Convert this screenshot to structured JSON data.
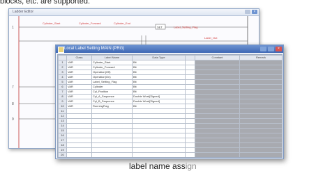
{
  "captions": {
    "top": "blocks, etc. are supported.",
    "bottom": "label name ass",
    "bottom_faint": "ign"
  },
  "back_window": {
    "title": "Ladder Editor",
    "rung_numbers": [
      "1",
      "7",
      "8",
      "9"
    ],
    "coil_labels": [
      "Cylinder_Start",
      "Cylinder_Forward",
      "Cylinder_End",
      "SET",
      "Label_Setting_Flag",
      "Label_Out"
    ]
  },
  "front_window": {
    "title": "Local Label Setting MAIN (PRG)",
    "columns": [
      "",
      "Class",
      "Label Name",
      "Data Type",
      "",
      "Constant",
      "Remark"
    ],
    "rows": [
      {
        "n": "1",
        "class": "VAR",
        "name": "Cylinder_Start",
        "type": "Bit"
      },
      {
        "n": "2",
        "class": "VAR",
        "name": "Cylinder_Forward",
        "type": "Bit"
      },
      {
        "n": "3",
        "class": "VAR",
        "name": "Operation(Off)",
        "type": "Bit"
      },
      {
        "n": "4",
        "class": "VAR",
        "name": "Operation(On)",
        "type": "Bit"
      },
      {
        "n": "5",
        "class": "VAR",
        "name": "Label_Setting_Flag",
        "type": "Bit"
      },
      {
        "n": "6",
        "class": "VAR",
        "name": "Cylinder",
        "type": "Bit"
      },
      {
        "n": "7",
        "class": "VAR",
        "name": "Cyl_Position",
        "type": "Bit"
      },
      {
        "n": "8",
        "class": "VAR",
        "name": "Cyl_A_Sequence",
        "type": "Double Word[Signed]"
      },
      {
        "n": "9",
        "class": "VAR",
        "name": "Cyl_B_Sequence",
        "type": "Double Word[Signed]"
      },
      {
        "n": "10",
        "class": "VAR",
        "name": "RunningFlag",
        "type": "Bit"
      },
      {
        "n": "11",
        "class": "",
        "name": "",
        "type": ""
      },
      {
        "n": "12",
        "class": "",
        "name": "",
        "type": ""
      },
      {
        "n": "13",
        "class": "",
        "name": "",
        "type": ""
      },
      {
        "n": "14",
        "class": "",
        "name": "",
        "type": ""
      },
      {
        "n": "15",
        "class": "",
        "name": "",
        "type": ""
      },
      {
        "n": "16",
        "class": "",
        "name": "",
        "type": ""
      },
      {
        "n": "17",
        "class": "",
        "name": "",
        "type": ""
      },
      {
        "n": "18",
        "class": "",
        "name": "",
        "type": ""
      },
      {
        "n": "19",
        "class": "",
        "name": "",
        "type": ""
      },
      {
        "n": "20",
        "class": "",
        "name": "",
        "type": ""
      }
    ]
  },
  "colors": {
    "title_bar": "#3e67b4",
    "label_red": "#d23a3a",
    "close_button": "#d9534f",
    "shaded_column": "#a8aab0"
  }
}
